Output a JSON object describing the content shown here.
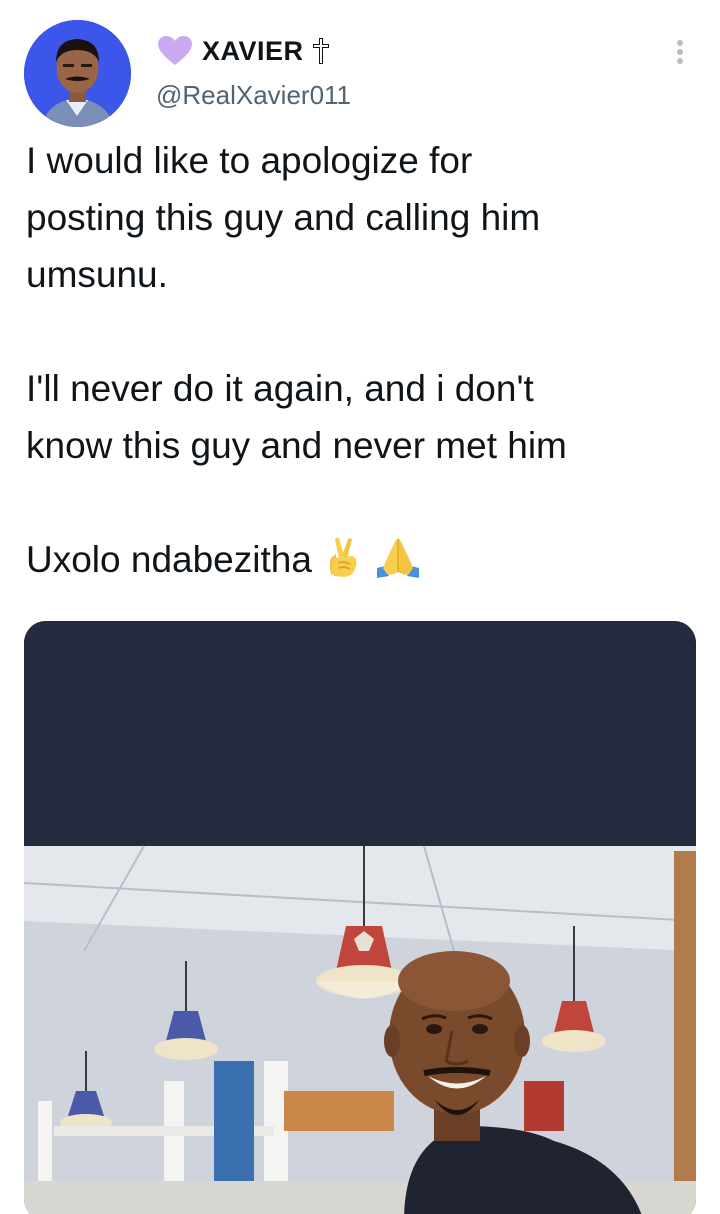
{
  "author": {
    "display_name": "XAVIER",
    "handle": "@RealXavier011",
    "name_prefix_icon": "purple-heart-icon",
    "name_suffix_icon": "latin-cross-icon"
  },
  "tweet": {
    "paragraphs": [
      [
        "I would like to apologize for",
        "posting this guy and calling him",
        "umsunu."
      ],
      [
        "I'll never do it again, and i don't",
        "know this guy and never met him"
      ],
      [
        "Uxolo ndabezitha"
      ]
    ],
    "trailing_emojis": [
      "crossed-fingers-icon",
      "folded-hands-icon"
    ]
  },
  "menu": {
    "icon": "more-vertical-icon"
  },
  "colors": {
    "text": "#0f1419",
    "secondary_text": "#536471",
    "heart": "#c9a9f0",
    "media_top": "#252a3f",
    "avatar_bg": "#3b56e8"
  }
}
